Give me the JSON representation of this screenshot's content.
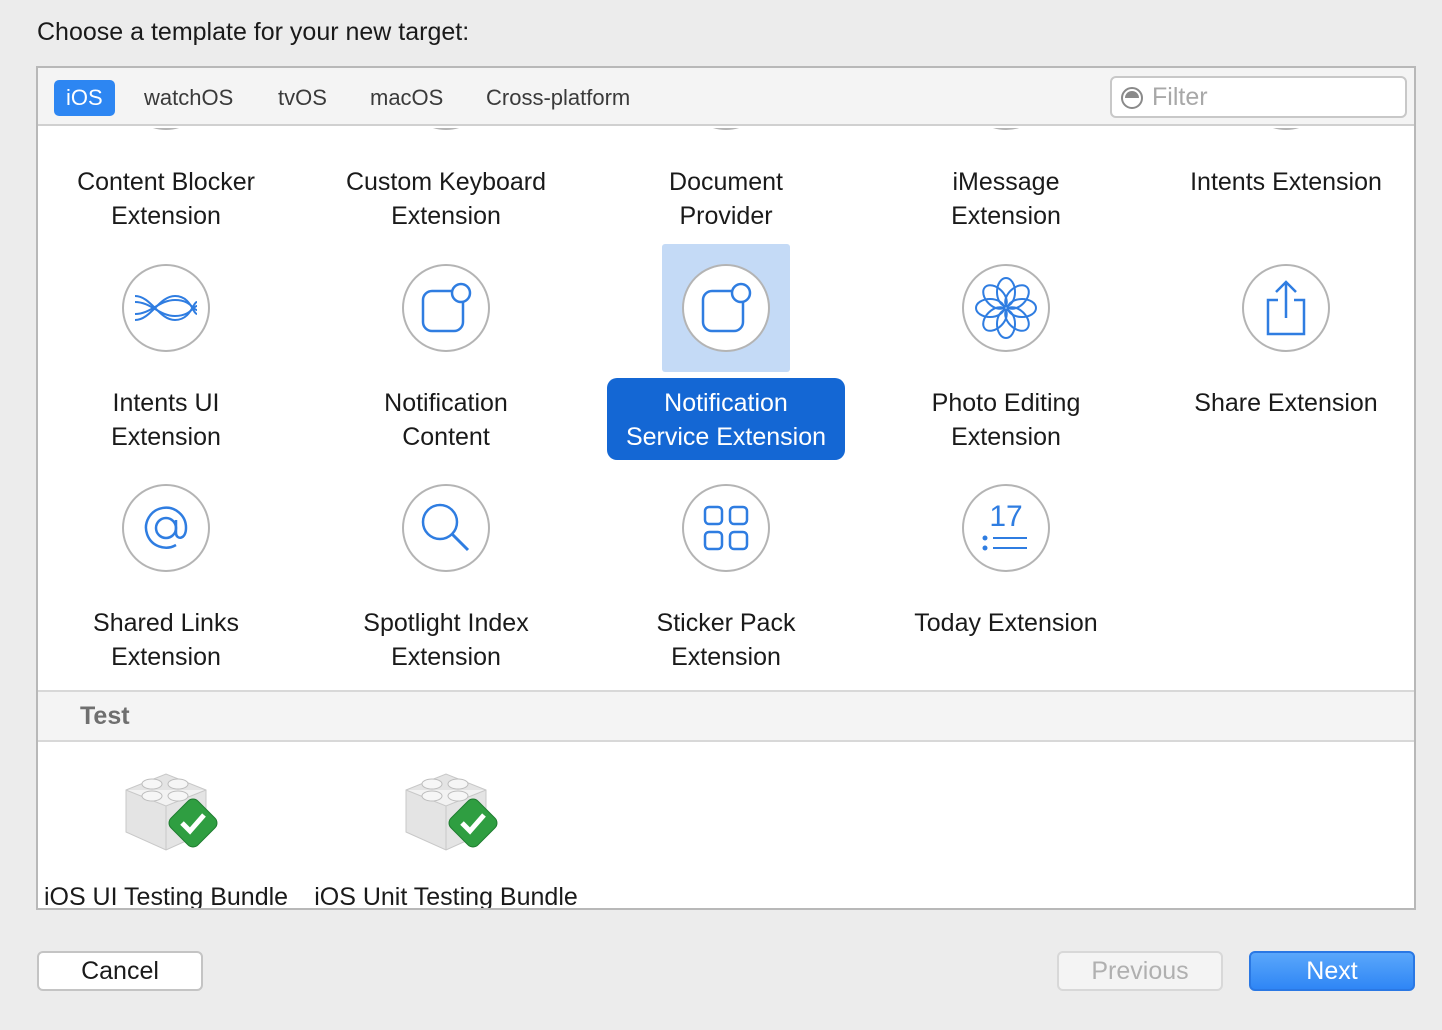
{
  "dialog": {
    "prompt": "Choose a template for your new target:"
  },
  "tabs": [
    {
      "label": "iOS",
      "active": true
    },
    {
      "label": "watchOS",
      "active": false
    },
    {
      "label": "tvOS",
      "active": false
    },
    {
      "label": "macOS",
      "active": false
    },
    {
      "label": "Cross-platform",
      "active": false
    }
  ],
  "filter": {
    "placeholder": "Filter",
    "value": ""
  },
  "templates": {
    "row1": [
      {
        "label": "Content Blocker\nExtension"
      },
      {
        "label": "Custom Keyboard\nExtension"
      },
      {
        "label": "Document\nProvider"
      },
      {
        "label": "iMessage\nExtension"
      },
      {
        "label": "Intents Extension"
      }
    ],
    "row2": [
      {
        "label": "Intents UI\nExtension",
        "icon": "waves-icon"
      },
      {
        "label": "Notification\nContent",
        "icon": "notification-icon"
      },
      {
        "label": "Notification\nService Extension",
        "icon": "notification-icon",
        "selected": true
      },
      {
        "label": "Photo Editing\nExtension",
        "icon": "flower-icon"
      },
      {
        "label": "Share Extension",
        "icon": "share-icon"
      }
    ],
    "row3": [
      {
        "label": "Shared Links\nExtension",
        "icon": "at-sign-icon"
      },
      {
        "label": "Spotlight Index\nExtension",
        "icon": "magnifier-icon"
      },
      {
        "label": "Sticker Pack\nExtension",
        "icon": "grid-icon"
      },
      {
        "label": "Today Extension",
        "icon": "calendar-icon",
        "icon_text": "17"
      }
    ]
  },
  "test_section": {
    "title": "Test",
    "items": [
      {
        "label": "iOS UI Testing Bundle",
        "icon": "test-bundle-icon"
      },
      {
        "label": "iOS Unit Testing Bundle",
        "icon": "test-bundle-icon"
      }
    ]
  },
  "buttons": {
    "cancel": "Cancel",
    "previous": "Previous",
    "next": "Next"
  },
  "colors": {
    "accent": "#2d86f2",
    "selection": "#1467d4",
    "icon_stroke": "#2f7de1"
  }
}
